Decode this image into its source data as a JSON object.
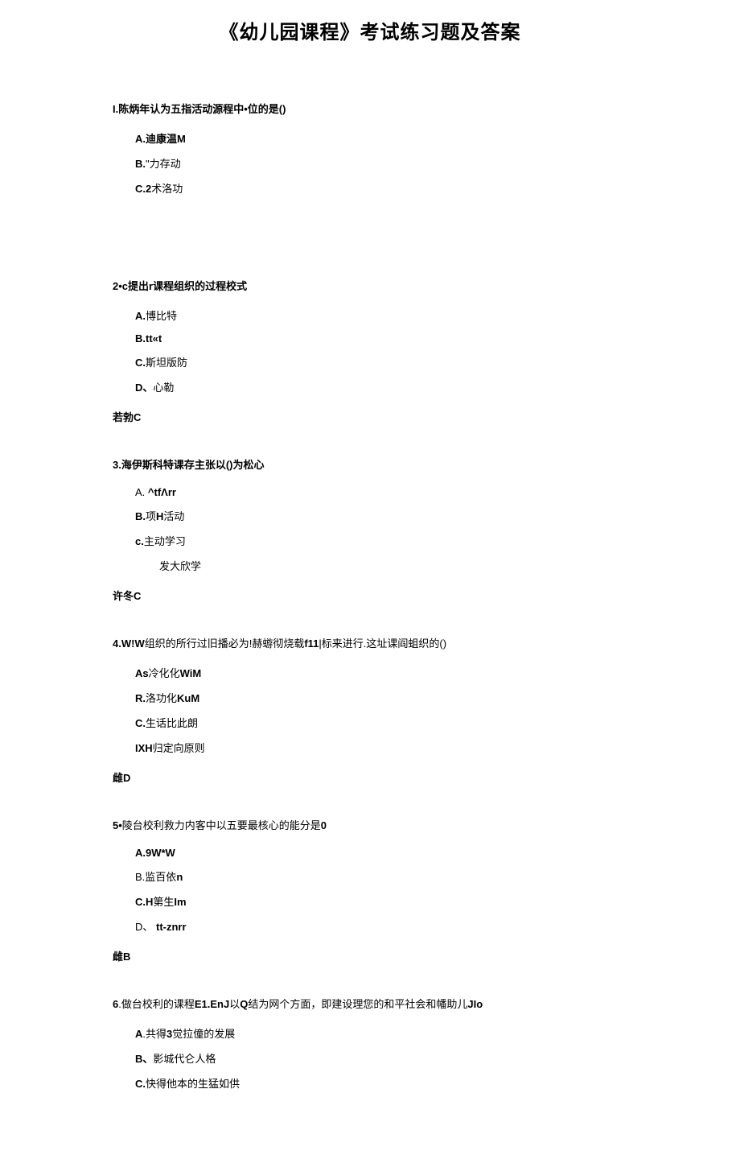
{
  "title": "《幼儿园课程》考试练习题及答案",
  "questions": [
    {
      "stem": "I.陈炳年认为五指活动源程中•位的是()",
      "options": [
        {
          "label": "A.",
          "text": "迪康温M",
          "bold_text": true
        },
        {
          "label": "B.",
          "text": "\"力存动"
        },
        {
          "label": "C.",
          "text": "2术洛功",
          "bold_after": "2"
        }
      ],
      "answer": "",
      "extra_space": true
    },
    {
      "stem": "2•c提出r课程组织的过程校式",
      "options": [
        {
          "label": "A.",
          "text": "博比特"
        },
        {
          "label": "B.",
          "text": "tt«t",
          "bold_text": true
        },
        {
          "label": "C.",
          "text": "斯坦版防"
        },
        {
          "label": "D、",
          "text": "心勒"
        }
      ],
      "answer": "若勃C"
    },
    {
      "stem": "3.海伊斯科特课存主张以()为松心",
      "options": [
        {
          "label": "A.",
          "text": " ^tfΛrr",
          "bold_text": true,
          "label_normal": true
        },
        {
          "label": "B.",
          "text": "项H活动",
          "mixed": "项",
          "bold_mid": "H",
          "after": "活动"
        },
        {
          "label": "c.",
          "text": "主动学习"
        },
        {
          "label": "",
          "text": "发大欣学",
          "deep": true
        }
      ],
      "answer": "许冬C"
    },
    {
      "stem_parts": [
        "4.W!W",
        "组织的所行过旧播必为!赫蝣彻烧载",
        "f11",
        "|标来进行.这址课阎蛆织的()"
      ],
      "options": [
        {
          "label": "As",
          "text": "冷化化",
          "suffix": "WiM"
        },
        {
          "label": "R.",
          "text": "洛功化",
          "suffix": "KuM"
        },
        {
          "label": "C.",
          "text": "生话比此朗"
        },
        {
          "label": "IXH",
          "text": "归定向原则"
        }
      ],
      "answer": "雌D"
    },
    {
      "stem_parts": [
        "5•",
        "陵台校利救力内客中以五要最核心的能分是",
        "0"
      ],
      "options": [
        {
          "label": "A.",
          "text": "9W*W",
          "bold_text": true
        },
        {
          "label": "B.",
          "text": "监百依",
          "suffix": "n",
          "label_normal": true
        },
        {
          "label": "C.",
          "text": "H第生",
          "bold_pre": "H",
          "after": "第生",
          "suffix": "Im"
        },
        {
          "label": "D、",
          "text": " tt-znrr",
          "bold_text": true,
          "label_normal": true
        }
      ],
      "answer": "雌B"
    },
    {
      "stem_parts": [
        "6",
        ".做台校利的课程",
        "E1.EnJ",
        "以",
        "Q",
        "结为网个方面，即建设理您的和平社会和幡助儿",
        "JIo"
      ],
      "options": [
        {
          "label": "A",
          "text": ".共得",
          "bold_mid": "3",
          "after": "觉拉僮的发展"
        },
        {
          "label": "B、",
          "text": "影城代仑人格"
        },
        {
          "label": "C.",
          "text": "快得他本的生猛如供"
        }
      ],
      "answer": ""
    }
  ]
}
